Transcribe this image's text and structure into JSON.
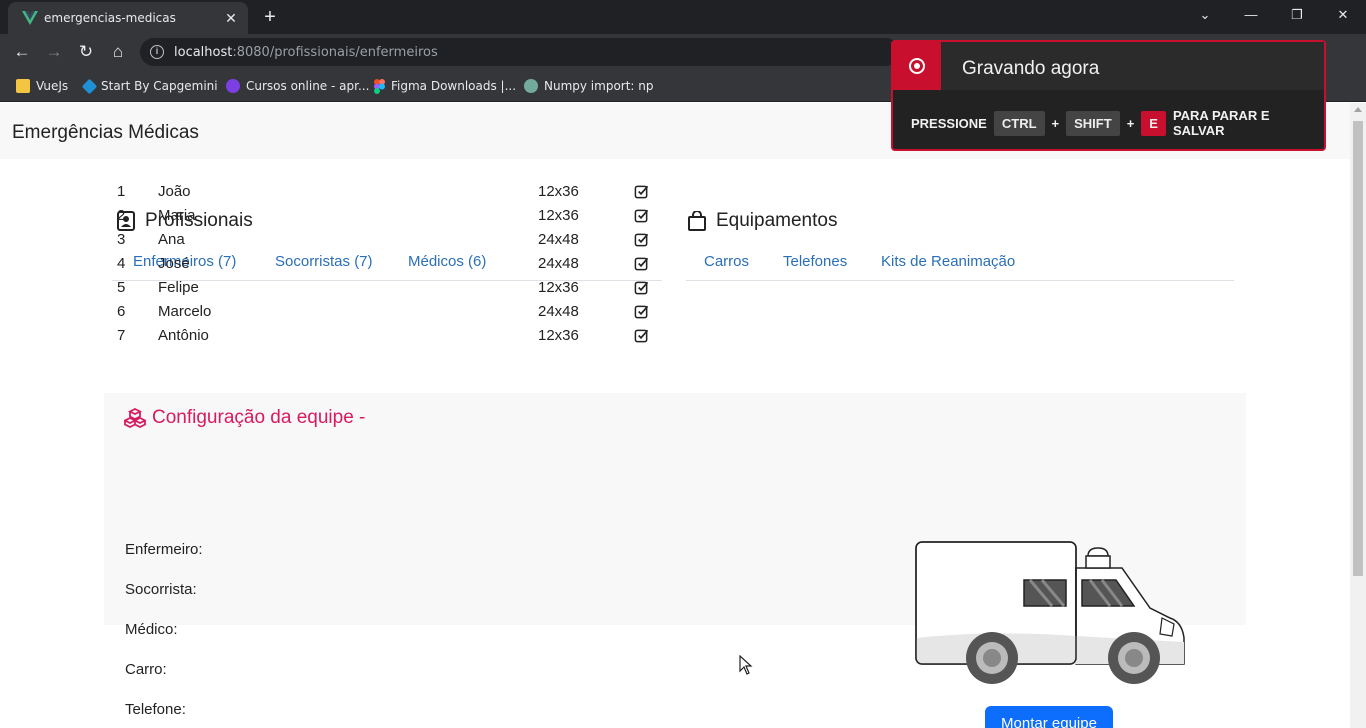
{
  "browser": {
    "tab_title": "emergencias-medicas",
    "tab_close": "✕",
    "new_tab": "+",
    "url_host": "localhost",
    "url_path": ":8080/profissionais/enfermeiros",
    "bookmarks": [
      "VueJs",
      "Start By Capgemini",
      "Cursos online - apr...",
      "Figma Downloads |...",
      "Numpy import: np"
    ]
  },
  "recording": {
    "title": "Gravando agora",
    "press": "PRESSIONE",
    "key_ctrl": "CTRL",
    "plus": "+",
    "key_shift": "SHIFT",
    "key_e": "E",
    "tail": "PARA PARAR E SALVAR"
  },
  "app": {
    "brand": "Emergências Médicas"
  },
  "profissionais": {
    "title": "Profissionais",
    "tabs": [
      "Enfermeiros (7)",
      "Socorristas (7)",
      "Médicos (6)"
    ],
    "rows": [
      {
        "num": "1",
        "name": "João",
        "size": "12x36"
      },
      {
        "num": "2",
        "name": "Maria",
        "size": "12x36"
      },
      {
        "num": "3",
        "name": "Ana",
        "size": "24x48"
      },
      {
        "num": "4",
        "name": "José",
        "size": "24x48"
      },
      {
        "num": "5",
        "name": "Felipe",
        "size": "12x36"
      },
      {
        "num": "6",
        "name": "Marcelo",
        "size": "24x48"
      },
      {
        "num": "7",
        "name": "Antônio",
        "size": "12x36"
      }
    ]
  },
  "equipamentos": {
    "title": "Equipamentos",
    "tabs": [
      "Carros",
      "Telefones",
      "Kits de Reanimação"
    ]
  },
  "config": {
    "title": "Configuração da equipe -",
    "fields": [
      "Enfermeiro:",
      "Socorrista:",
      "Médico:",
      "Carro:",
      "Telefone:"
    ],
    "button": "Montar equipe"
  },
  "colors": {
    "accent_pink": "#d81b60",
    "link_blue": "#2a6fb8",
    "recording_red": "#c8102e"
  }
}
